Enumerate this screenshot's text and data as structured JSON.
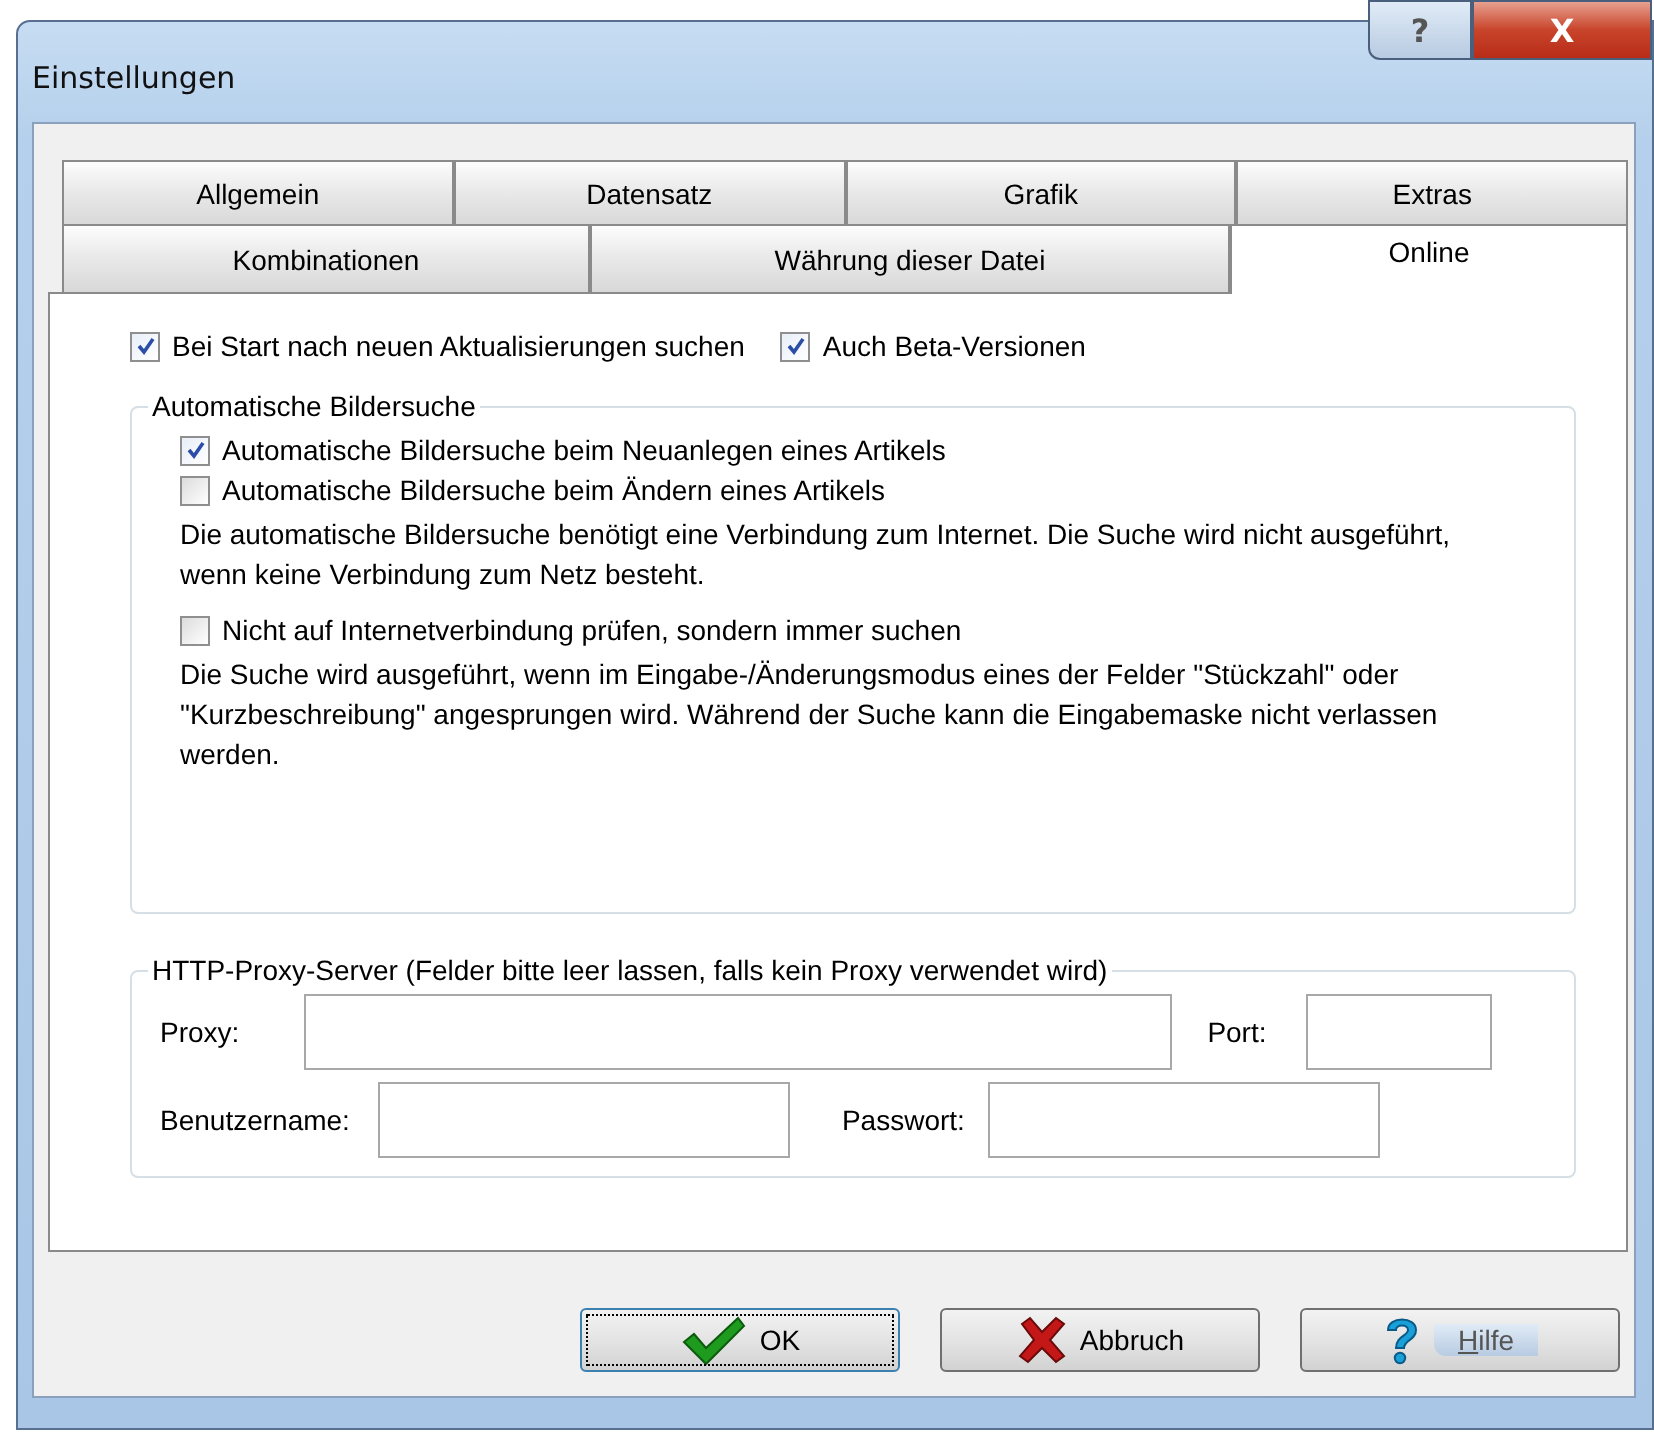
{
  "window": {
    "title": "Einstellungen",
    "help_button": "?",
    "close_button": "X"
  },
  "tab_rows": [
    [
      {
        "label": "Allgemein",
        "selected": false
      },
      {
        "label": "Datensatz",
        "selected": false
      },
      {
        "label": "Grafik",
        "selected": false
      },
      {
        "label": "Extras",
        "selected": false
      }
    ],
    [
      {
        "label": "Kombinationen",
        "selected": false
      },
      {
        "label": "Währung dieser Datei",
        "selected": false
      },
      {
        "label": "Online",
        "selected": true
      }
    ]
  ],
  "top_options": [
    {
      "label": "Bei Start nach neuen Aktualisierungen suchen",
      "checked": true
    },
    {
      "label": "Auch Beta-Versionen",
      "checked": true
    }
  ],
  "image_search": {
    "title": "Automatische Bildersuche",
    "items": [
      {
        "kind": "checkbox",
        "label": "Automatische Bildersuche beim Neuanlegen eines Artikels",
        "checked": true
      },
      {
        "kind": "checkbox",
        "label": "Automatische Bildersuche beim Ändern eines Artikels",
        "checked": false
      },
      {
        "kind": "note",
        "text": "Die automatische Bildersuche benötigt eine Verbindung zum Internet. Die Suche wird nicht ausgeführt, wenn keine Verbindung zum Netz besteht."
      },
      {
        "kind": "checkbox",
        "label": "Nicht auf Internetverbindung prüfen, sondern immer suchen",
        "checked": false
      },
      {
        "kind": "note",
        "text": "Die Suche wird ausgeführt, wenn im Eingabe-/Änderungsmodus eines der Felder \"Stückzahl\" oder \"Kurzbeschreibung\" angesprungen wird. Während der Suche kann die Eingabemaske nicht verlassen werden."
      }
    ]
  },
  "proxy": {
    "title": "HTTP-Proxy-Server (Felder bitte leer lassen, falls kein Proxy verwendet wird)",
    "rows": [
      [
        {
          "label": "Proxy:"
        },
        {
          "label": "Port:"
        }
      ],
      [
        {
          "label": "Benutzername:"
        },
        {
          "label": "Passwort:"
        }
      ]
    ]
  },
  "buttons": [
    {
      "kind": "ok",
      "label": "OK",
      "focused": true
    },
    {
      "kind": "cancel",
      "label": "Abbruch",
      "focused": false
    },
    {
      "kind": "help",
      "label": "Hilfe",
      "focused": false
    }
  ]
}
